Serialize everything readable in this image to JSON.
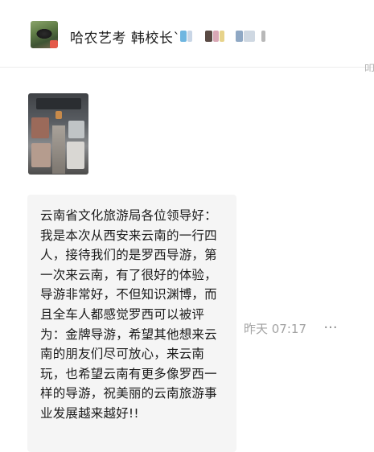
{
  "chat": {
    "title": "哈农艺考 韩校长`",
    "edge_glyph": "叩"
  },
  "messages": [
    {
      "type": "image",
      "image_desc": "photo-inside-bus"
    },
    {
      "type": "text",
      "text": "云南省文化旅游局各位领导好：我是本次从西安来云南的一行四人，接待我们的是罗西导游，第一次来云南，有了很好的体验，导游非常好，不但知识渊博，而且全车人都感觉罗西可以被评为：金牌导游，希望其他想来云南的朋友们尽可放心，来云南玩，也希望云南有更多像罗西一样的导游，祝美丽的云南旅游事业发展越来越好!!",
      "timestamp": "昨天 07:17",
      "more": "···"
    }
  ],
  "colors": {
    "bubble_bg": "#f5f5f5",
    "timestamp": "#a3a3a3",
    "text": "#1a1a1a"
  }
}
